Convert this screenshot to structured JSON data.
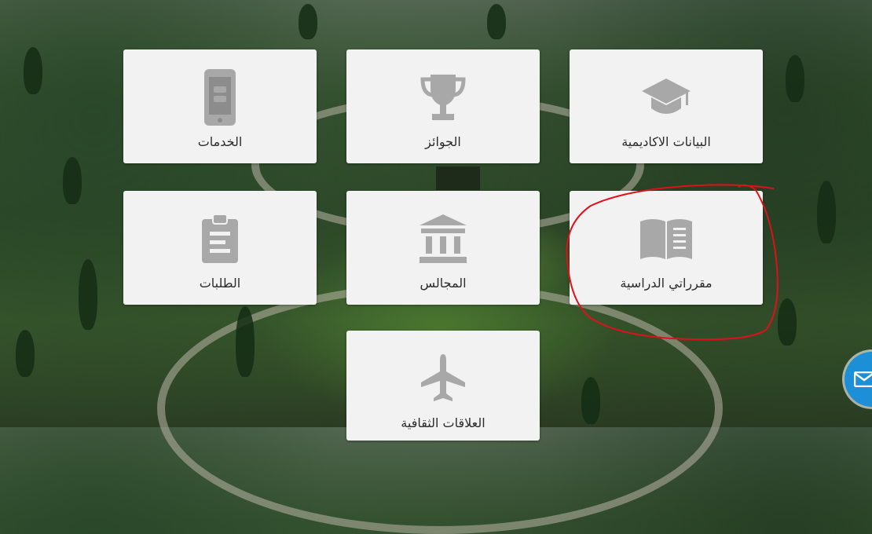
{
  "tiles": {
    "academic": {
      "label": "البيانات الاكاديمية",
      "icon": "graduation-cap-icon"
    },
    "awards": {
      "label": "الجوائز",
      "icon": "trophy-icon"
    },
    "services": {
      "label": "الخدمات",
      "icon": "mobile-phone-icon"
    },
    "courses": {
      "label": "مقرراتي الدراسية",
      "icon": "open-book-icon"
    },
    "councils": {
      "label": "المجالس",
      "icon": "institution-icon"
    },
    "requests": {
      "label": "الطلبات",
      "icon": "clipboard-icon"
    },
    "relations": {
      "label": "العلاقات الثقافية",
      "icon": "airplane-icon"
    }
  },
  "colors": {
    "tile_background": "#f2f2f2",
    "icon_gray": "#a8a8a8",
    "label_text": "#2b2b2b",
    "annotation_red": "#e0101a",
    "mail_button": "#1d8fd6"
  },
  "mail_button": {
    "icon": "envelope-icon"
  }
}
